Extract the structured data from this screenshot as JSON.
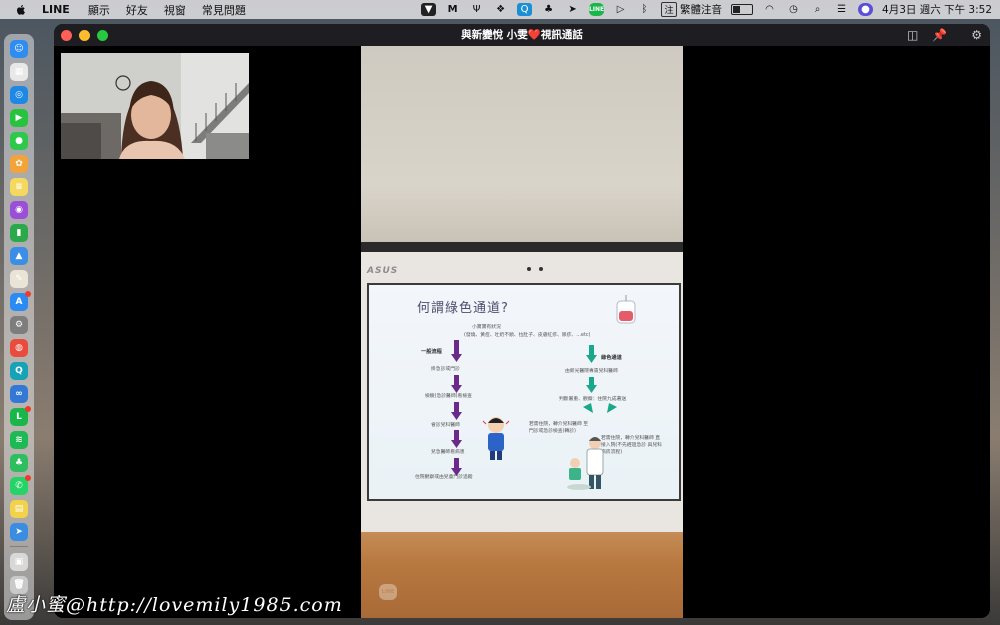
{
  "menubar": {
    "app_name": "LINE",
    "menus": [
      "顯示",
      "好友",
      "視窗",
      "常見問題"
    ],
    "input_method": "繁體注音",
    "datetime": "4月3日 週六 下午 3:52"
  },
  "dock": {
    "apps": [
      {
        "name": "finder-icon",
        "color": "#2f8cf0",
        "glyph": "☺"
      },
      {
        "name": "launchpad-icon",
        "color": "#e8e8e8",
        "glyph": "▦"
      },
      {
        "name": "safari-icon",
        "color": "#1e88e5",
        "glyph": "◎"
      },
      {
        "name": "facetime-icon",
        "color": "#27c23e",
        "glyph": "▶"
      },
      {
        "name": "messages-icon",
        "color": "#2ec84a",
        "glyph": "●"
      },
      {
        "name": "photos-icon",
        "color": "#f2a33a",
        "glyph": "✿"
      },
      {
        "name": "notes-icon",
        "color": "#f5d85e",
        "glyph": "≡"
      },
      {
        "name": "podcasts-icon",
        "color": "#9b4fd6",
        "glyph": "◉"
      },
      {
        "name": "numbers-icon",
        "color": "#2aa84a",
        "glyph": "▮"
      },
      {
        "name": "keynote-icon",
        "color": "#3b8ee6",
        "glyph": "▲"
      },
      {
        "name": "pencil-app-icon",
        "color": "#e9e4d6",
        "glyph": "✎"
      },
      {
        "name": "app-store-icon",
        "color": "#2a8bf2",
        "glyph": "A"
      },
      {
        "name": "system-preferences-icon",
        "color": "#7d7d7d",
        "glyph": "⚙"
      },
      {
        "name": "chrome-icon",
        "color": "#e94b3c",
        "glyph": "◍"
      },
      {
        "name": "search-app-icon",
        "color": "#16a3b8",
        "glyph": "Q"
      },
      {
        "name": "cloud-app-icon",
        "color": "#3478d6",
        "glyph": "∞"
      },
      {
        "name": "line-icon",
        "color": "#19b74a",
        "glyph": "L"
      },
      {
        "name": "spotify-icon",
        "color": "#1db954",
        "glyph": "≋"
      },
      {
        "name": "evernote-icon",
        "color": "#2dbe60",
        "glyph": "♣"
      },
      {
        "name": "whatsapp-icon",
        "color": "#25d366",
        "glyph": "✆"
      },
      {
        "name": "stickies-icon",
        "color": "#f3d24b",
        "glyph": "▤"
      },
      {
        "name": "paper-plane-app-icon",
        "color": "#3a8de0",
        "glyph": "➤"
      },
      {
        "name": "preview-icon",
        "color": "#d8d8d8",
        "glyph": "▣"
      },
      {
        "name": "trash-icon",
        "color": "#c9c9c9",
        "glyph": "🗑"
      }
    ]
  },
  "window": {
    "title_prefix": "與新變悅 小雯",
    "title_suffix": "視訊通話"
  },
  "slide": {
    "title": "何謂綠色通道?",
    "subtitle_line1": "小寶寶有狀況",
    "subtitle_line2": "(發燒、黃疸、吐奶不順、拉肚子、皮膚紅疹、尿疹、…etc)",
    "left_label": "一般流程",
    "right_label": "綠色通道",
    "left_steps": [
      "掛急診或門診",
      "檢驗(急診醫師)看檢查",
      "會診兒科醫師",
      "兒急醫師看病患",
      "住院觀察或由兒童門診追蹤"
    ],
    "right_steps": [
      "由新光醫院專責兒科醫師",
      "判斷嚴重、觀察：住院九成著送"
    ],
    "bottom_left": "若需住院，轉介兒科醫師 至門診或急診檢查(轉診)",
    "bottom_right": "若需住院，轉介兒科醫師 直接入院(不先經過急診 與兒科病房流程)"
  },
  "remote": {
    "tablet_brand": "ASUS",
    "line_watermark": "LINE"
  },
  "watermark": "盧小蜜@http://lovemily1985.com"
}
